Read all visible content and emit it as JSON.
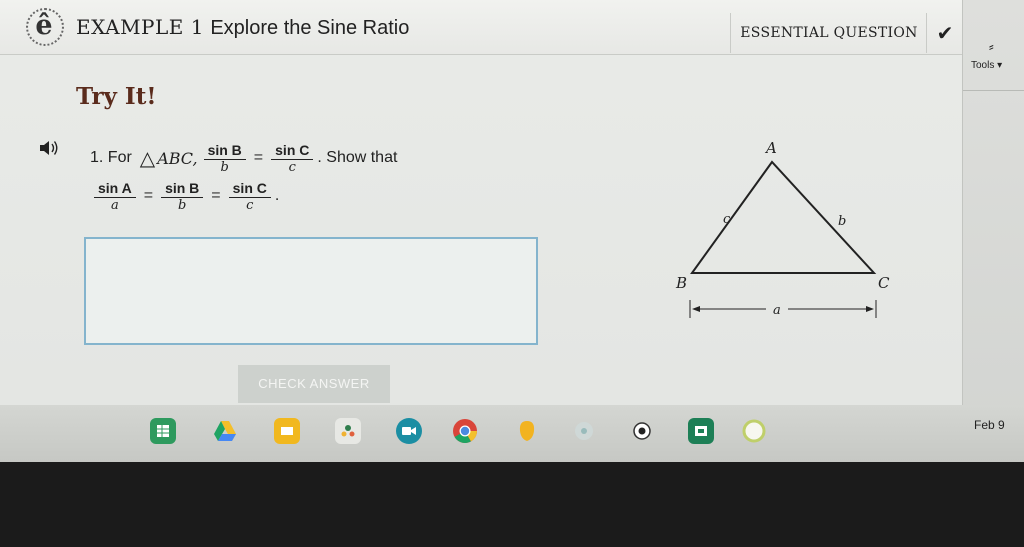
{
  "header": {
    "title_example": "EXAMPLE 1",
    "title_rest": "Explore the Sine Ratio",
    "essential_question_label": "ESSENTIAL QUESTION",
    "check_icon_glyph": "✔",
    "logo_glyph": "ê"
  },
  "tools": {
    "icon_glyph": "⸗",
    "label": "Tools ▾"
  },
  "main": {
    "heading": "Try It!",
    "problem_number": "1. For",
    "triangle_symbol": "△",
    "triangle_name": "ABC,",
    "given": {
      "left_num": "sin B",
      "left_den": "b",
      "equals": "=",
      "right_num": "sin C",
      "right_den": "c",
      "suffix": ". Show that"
    },
    "show": {
      "a_num": "sin A",
      "a_den": "a",
      "b_num": "sin B",
      "b_den": "b",
      "c_num": "sin C",
      "c_den": "c",
      "eq1": "=",
      "eq2": "=",
      "end": "."
    },
    "answer_placeholder": "",
    "check_answer_label": "CHECK ANSWER"
  },
  "diagram": {
    "vertex_a": "A",
    "vertex_b": "B",
    "vertex_c": "C",
    "side_a": "a",
    "side_b": "b",
    "side_c": "c"
  },
  "shelf": {
    "apps": [
      "sheets",
      "drive",
      "slides",
      "classroom",
      "meet",
      "chrome",
      "keep",
      "photos",
      "camera",
      "screencast",
      "timer"
    ],
    "date": "Feb 9"
  },
  "colors": {
    "accent_border": "#84b4cd",
    "heading_color": "#5a2b1c"
  }
}
